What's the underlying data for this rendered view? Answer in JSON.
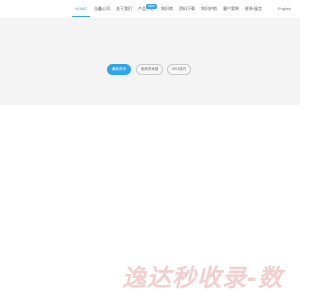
{
  "nav": {
    "items": [
      {
        "label": "HOME",
        "active": true
      },
      {
        "label": "当鑫公司",
        "active": false
      },
      {
        "label": "关于我们",
        "active": false
      },
      {
        "label": "产品中心",
        "active": false
      },
      {
        "label": "知识库",
        "active": false
      },
      {
        "label": "资料下载",
        "active": false
      },
      {
        "label": "知识护航",
        "active": false
      },
      {
        "label": "客户案例",
        "active": false
      },
      {
        "label": "联系/留言",
        "active": false
      }
    ],
    "badge": "NEW",
    "lang": "English"
  },
  "hero": {
    "buttons": [
      {
        "label": "最新资讯",
        "primary": true
      },
      {
        "label": "电商学术馆",
        "primary": false
      },
      {
        "label": "SEO技巧",
        "primary": false
      }
    ]
  },
  "watermark": {
    "text": "逸达秒收录-数"
  },
  "colors": {
    "accent": "#3aa6e8",
    "hero_bg": "#f4f4f4",
    "watermark": "#f3cfcf"
  }
}
